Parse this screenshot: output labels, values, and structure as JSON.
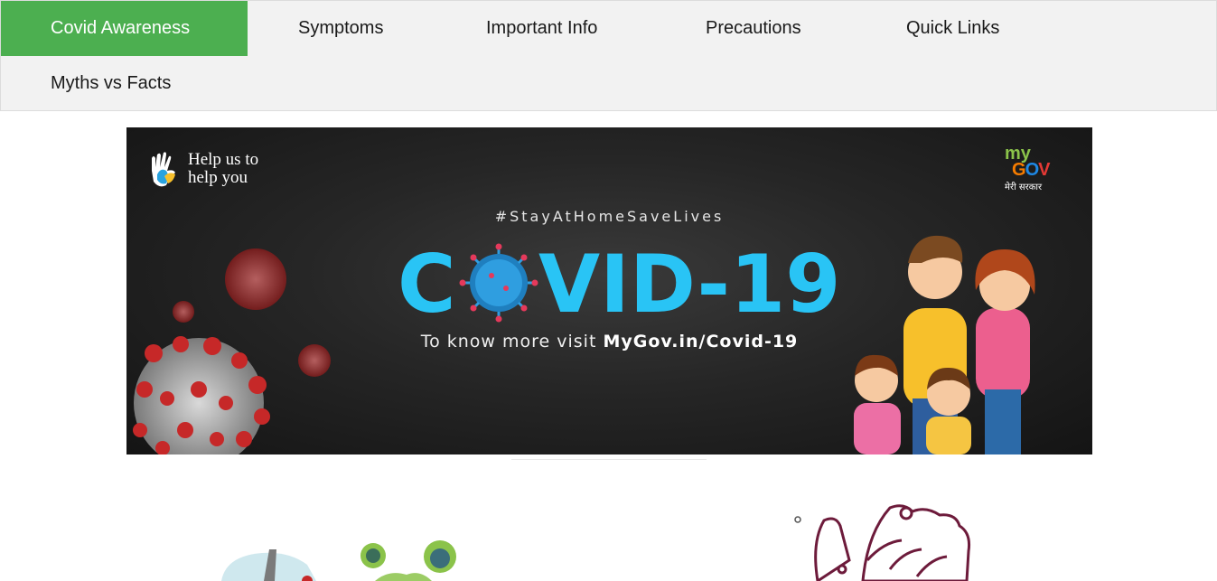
{
  "tabs": [
    {
      "label": "Covid Awareness",
      "active": true
    },
    {
      "label": "Symptoms",
      "active": false
    },
    {
      "label": "Important Info",
      "active": false
    },
    {
      "label": "Precautions",
      "active": false
    },
    {
      "label": "Quick Links",
      "active": false
    },
    {
      "label": "Myths vs Facts",
      "active": false
    }
  ],
  "banner": {
    "help_text": "Help us to help you",
    "mygov_my": "my",
    "mygov_gov_g": "G",
    "mygov_gov_o": "O",
    "mygov_gov_v": "V",
    "mygov_tagline": "मेरी सरकार",
    "hashtag": "#StayAtHomeSaveLives",
    "title_c": "C",
    "title_rest": "VID-19",
    "visit_prefix": "To know more visit",
    "visit_link": "MyGov.in/Covid-19"
  },
  "colors": {
    "active_tab": "#4caf50",
    "tabbar_bg": "#f2f2f2",
    "title_cyan": "#29c4f5",
    "virus_red": "#c62828"
  },
  "icons": [
    "helping-hands-icon",
    "virus-icon",
    "family-illustration",
    "hand-wash-illustration"
  ]
}
